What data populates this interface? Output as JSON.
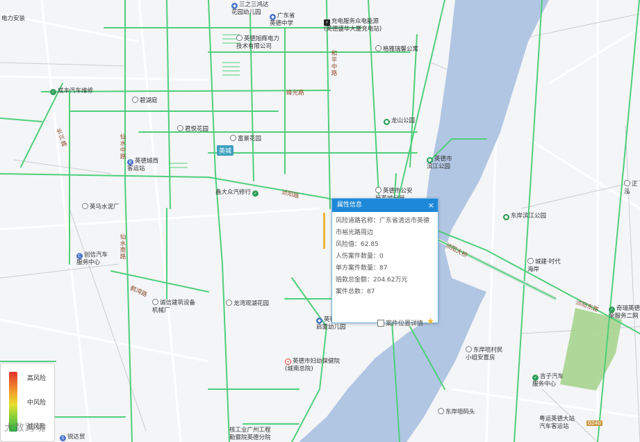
{
  "map": {
    "labels": [
      {
        "text": "电力安装",
        "icon": "none"
      },
      {
        "text": "三之三鸿达\n花园幼儿园",
        "icon": "blue"
      },
      {
        "text": "广东省\n英德中学",
        "icon": "blue"
      },
      {
        "text": "充电服务众电能源\n(英德盛华大厦充电站)",
        "icon": "charge"
      },
      {
        "text": "英德旭辉电力\n技术有限公司",
        "icon": "ring"
      },
      {
        "text": "格雅瑞馨公寓",
        "icon": "ring"
      },
      {
        "text": "成丰汽车维修",
        "icon": "green"
      },
      {
        "text": "碧湖庭",
        "icon": "ring"
      },
      {
        "text": "龙山公园",
        "icon": "green"
      },
      {
        "text": "君悦花园",
        "icon": "ring"
      },
      {
        "text": "富景花园",
        "icon": "ring"
      },
      {
        "text": "英德城西\n客运站",
        "icon": "blue"
      },
      {
        "text": "英德市\n滨江公园",
        "icon": "green"
      },
      {
        "text": "鑫大众汽修行",
        "icon": "green"
      },
      {
        "text": "英德市公安\n局英城分局",
        "icon": "ring"
      },
      {
        "text": "英马水泥厂",
        "icon": "ring"
      },
      {
        "text": "东岸滨江公园",
        "icon": "green"
      },
      {
        "text": "创信汽车\n服务中心",
        "icon": "blue"
      },
      {
        "text": "城建·时代\n海岸",
        "icon": "ring"
      },
      {
        "text": "诚信建筑设备\n机械厂",
        "icon": "ring"
      },
      {
        "text": "龙湾观湖花园",
        "icon": "ring"
      },
      {
        "text": "英德市城南\n启蒙幼儿园",
        "icon": "blue"
      },
      {
        "text": "奇瑞英德福\n荣服务二网",
        "icon": "green"
      },
      {
        "text": "东岸咀村民\n小组安置房",
        "icon": "ring"
      },
      {
        "text": "英德市妇幼保健院\n(城南总院)",
        "icon": "hospital"
      },
      {
        "text": "吉子汽车\n服务中心",
        "icon": "green"
      },
      {
        "text": "东岸咀码头",
        "icon": "ring"
      },
      {
        "text": "粤运英德大站\n汽车客运站",
        "icon": "ring"
      },
      {
        "text": "核工业广州工程\n勘察院英德分院",
        "icon": "ring"
      },
      {
        "text": "锐达贸",
        "icon": "blue"
      },
      {
        "text": "正泓",
        "icon": "ring"
      }
    ],
    "roads": [
      "和平中路",
      "峰光路",
      "仙水中路",
      "长兴路",
      "浈阳路",
      "浈阳大桥",
      "仙水南路",
      "鹤湾路",
      "浈阳东路"
    ],
    "district": "英城",
    "highway": "G240"
  },
  "popup": {
    "title": "属性信息",
    "close": "×",
    "road_name_label": "风险道路名称：",
    "road_name": "广东省清远市英德市裕光路周边",
    "risk_value_label": "风险值：",
    "risk_value": "62.85",
    "injury_cases_label": "人伤案件数量：",
    "injury_cases": "0",
    "single_cases_label": "单方案件数量：",
    "single_cases": "87",
    "compensation_label": "赔款总金额：",
    "compensation": "204.62万元",
    "total_cases_label": "案件总数：",
    "total_cases": "87",
    "location_detail": "案件位置详情"
  },
  "legend": {
    "high": "高风险",
    "mid": "中风险",
    "low": "低风险"
  },
  "watermark": "大数跨境",
  "colors": {
    "water": "#b1c6e3",
    "road_low_risk": "#4fcf7a",
    "road_base": "#e2e4e8",
    "green_area": "#a7d48e",
    "popup_header": "#1e88d8"
  }
}
